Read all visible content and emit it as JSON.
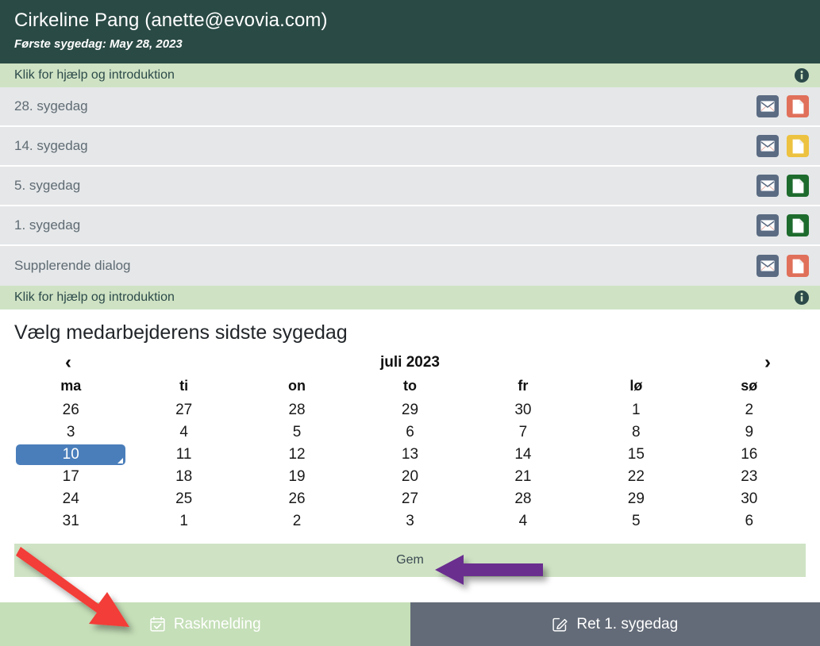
{
  "header": {
    "title": "Cirkeline Pang (anette@evovia.com)",
    "subtitle": "Første sygedag: May 28, 2023"
  },
  "help_bar_top": {
    "text": "Klik for hjælp og introduktion",
    "icon": "info-circle-icon"
  },
  "help_bar_bottom": {
    "text": "Klik for hjælp og introduktion",
    "icon": "info-circle-icon"
  },
  "colors": {
    "header_bg": "#2a4a45",
    "help_bg": "#cfe3c4",
    "row_bg": "#e5e7e9",
    "mail_icon_bg": "#5a6b82",
    "doc_red": "#e0705a",
    "doc_yellow": "#edc240",
    "doc_green": "#1e6b2e",
    "selected_day": "#4a7ebb",
    "footer_green": "#c5dfb8",
    "footer_gray": "#636b78",
    "arrow_red": "#f33c38",
    "arrow_purple": "#6b2d8f"
  },
  "rows": [
    {
      "label": "28. sygedag",
      "mail_icon": "envelope-icon",
      "doc_icon": "document-icon",
      "doc_color": "#e0705a"
    },
    {
      "label": "14. sygedag",
      "mail_icon": "envelope-icon",
      "doc_icon": "document-icon",
      "doc_color": "#edc240"
    },
    {
      "label": "5. sygedag",
      "mail_icon": "envelope-icon",
      "doc_icon": "document-icon",
      "doc_color": "#1e6b2e"
    },
    {
      "label": "1. sygedag",
      "mail_icon": "envelope-icon",
      "doc_icon": "document-icon",
      "doc_color": "#1e6b2e"
    },
    {
      "label": "Supplerende dialog",
      "mail_icon": "envelope-icon",
      "doc_icon": "document-icon",
      "doc_color": "#e0705a"
    }
  ],
  "calendar": {
    "title": "Vælg medarbejderens sidste sygedag",
    "month_label": "juli 2023",
    "prev_icon": "chevron-left-icon",
    "next_icon": "chevron-right-icon",
    "weekdays": [
      "ma",
      "ti",
      "on",
      "to",
      "fr",
      "lø",
      "sø"
    ],
    "selected_day": 10,
    "weeks": [
      [
        {
          "d": "26",
          "muted": true
        },
        {
          "d": "27",
          "muted": true
        },
        {
          "d": "28",
          "muted": true
        },
        {
          "d": "29",
          "muted": true
        },
        {
          "d": "30",
          "muted": true
        },
        {
          "d": "1",
          "muted": false
        },
        {
          "d": "2",
          "muted": false
        }
      ],
      [
        {
          "d": "3",
          "muted": false
        },
        {
          "d": "4",
          "muted": false
        },
        {
          "d": "5",
          "muted": false
        },
        {
          "d": "6",
          "muted": false
        },
        {
          "d": "7",
          "muted": false
        },
        {
          "d": "8",
          "muted": false
        },
        {
          "d": "9",
          "muted": false
        }
      ],
      [
        {
          "d": "10",
          "muted": false,
          "selected": true
        },
        {
          "d": "11",
          "muted": false
        },
        {
          "d": "12",
          "muted": false
        },
        {
          "d": "13",
          "muted": false
        },
        {
          "d": "14",
          "muted": false
        },
        {
          "d": "15",
          "muted": false
        },
        {
          "d": "16",
          "muted": false
        }
      ],
      [
        {
          "d": "17",
          "muted": false
        },
        {
          "d": "18",
          "muted": false
        },
        {
          "d": "19",
          "muted": false
        },
        {
          "d": "20",
          "muted": false
        },
        {
          "d": "21",
          "muted": false
        },
        {
          "d": "22",
          "muted": false
        },
        {
          "d": "23",
          "muted": false
        }
      ],
      [
        {
          "d": "24",
          "muted": false
        },
        {
          "d": "25",
          "muted": false
        },
        {
          "d": "26",
          "muted": false
        },
        {
          "d": "27",
          "muted": false
        },
        {
          "d": "28",
          "muted": false
        },
        {
          "d": "29",
          "muted": false
        },
        {
          "d": "30",
          "muted": false
        }
      ],
      [
        {
          "d": "31",
          "muted": false
        },
        {
          "d": "1",
          "muted": true
        },
        {
          "d": "2",
          "muted": true
        },
        {
          "d": "3",
          "muted": true
        },
        {
          "d": "4",
          "muted": true
        },
        {
          "d": "5",
          "muted": true
        },
        {
          "d": "6",
          "muted": true
        }
      ]
    ]
  },
  "save_bar": {
    "label": "Gem"
  },
  "footer": {
    "primary": {
      "label": "Raskmelding",
      "icon": "calendar-check-icon"
    },
    "secondary": {
      "label": "Ret 1. sygedag",
      "icon": "pencil-square-icon"
    }
  },
  "annotations": [
    {
      "name": "red-arrow",
      "color": "#f33c38",
      "points_to": "Raskmelding"
    },
    {
      "name": "purple-arrow",
      "color": "#6b2d8f",
      "points_to": "Gem"
    }
  ]
}
